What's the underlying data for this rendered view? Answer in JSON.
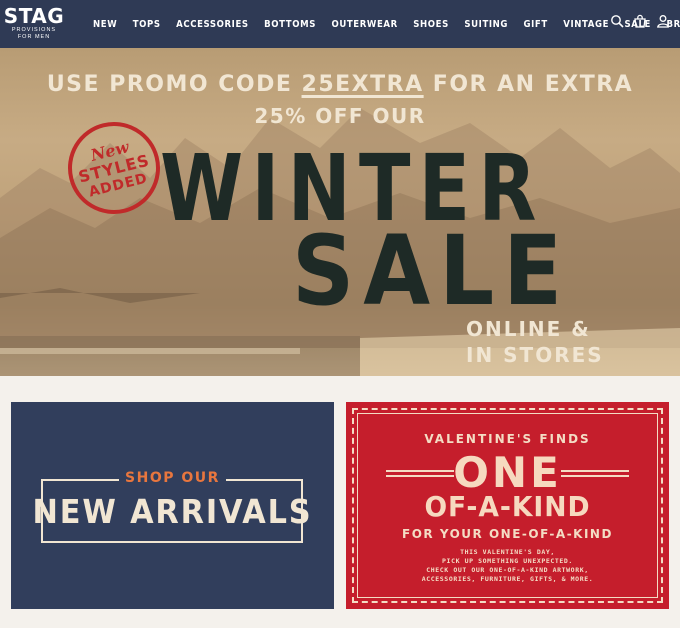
{
  "brand": {
    "name": "STAG",
    "tagline_line1": "PROVISIONS",
    "tagline_line2": "FOR MEN"
  },
  "nav": {
    "items": [
      "NEW",
      "TOPS",
      "ACCESSORIES",
      "BOTTOMS",
      "OUTERWEAR",
      "SHOES",
      "SUITING",
      "GIFT",
      "VINTAGE",
      "SALE",
      "BRANDS"
    ],
    "icons": [
      "search-icon",
      "bag-icon",
      "account-icon"
    ]
  },
  "hero": {
    "promo_prefix": "USE PROMO CODE ",
    "promo_code": "25EXTRA",
    "promo_suffix": " FOR AN EXTRA",
    "promo_line2": "25% OFF OUR",
    "headline_1": "WINTER",
    "headline_2": "SALE",
    "channels_line1": "ONLINE &",
    "channels_line2": "IN STORES",
    "stamp": {
      "line1": "New",
      "line2": "STYLES",
      "line3": "ADDED"
    }
  },
  "cards": {
    "new_arrivals": {
      "kicker": "SHOP OUR",
      "title": "NEW ARRIVALS"
    },
    "valentines": {
      "kicker": "VALENTINE'S FINDS",
      "title_1": "ONE",
      "title_2": "OF-A-KIND",
      "subtitle": "FOR YOUR ONE-OF-A-KIND",
      "body": [
        "THIS VALENTINE'S DAY,",
        "PICK UP SOMETHING UNEXPECTED.",
        "CHECK OUT OUR ONE-OF-A-KIND ARTWORK,",
        "ACCESSORIES, FURNITURE, GIFTS, & MORE."
      ]
    }
  },
  "colors": {
    "nav": "#2f3a55",
    "navy_card": "#313e5c",
    "red_card": "#c51e2c",
    "accent_orange": "#e8763e",
    "cream": "#f1e6d3"
  }
}
